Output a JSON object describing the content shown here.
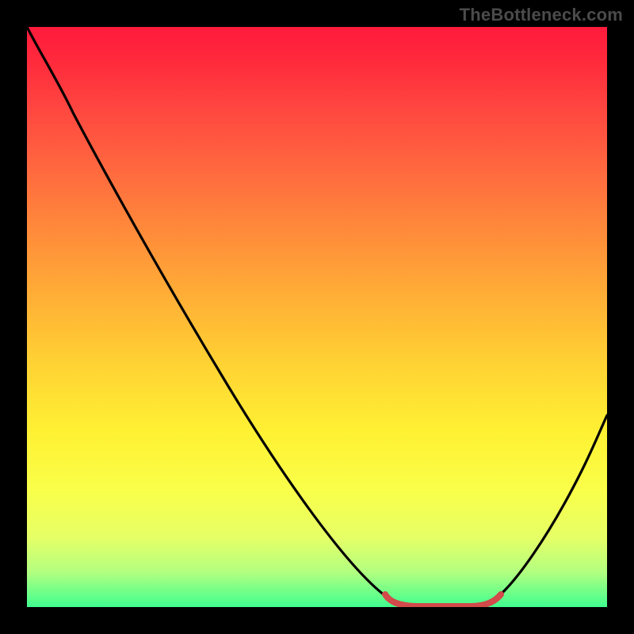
{
  "watermark": "TheBottleneck.com",
  "chart_data": {
    "type": "line",
    "title": "",
    "xlabel": "",
    "ylabel": "",
    "xlim": [
      0,
      1
    ],
    "ylim": [
      0,
      100
    ],
    "gradient_colors": {
      "top": "#ff1a3c",
      "mid_upper": "#ff8a3a",
      "mid": "#fff133",
      "mid_lower": "#e6ff66",
      "bottom": "#3fff8f"
    },
    "series": [
      {
        "name": "bottleneck-curve",
        "color": "#000000",
        "x": [
          0.0,
          0.06,
          0.12,
          0.2,
          0.3,
          0.4,
          0.5,
          0.58,
          0.63,
          0.66,
          0.72,
          0.78,
          0.82,
          0.86,
          0.92,
          1.0
        ],
        "y": [
          100,
          93,
          86,
          75,
          60,
          46,
          31,
          18,
          8,
          2,
          0,
          0,
          2,
          7,
          17,
          33
        ]
      },
      {
        "name": "optimal-range-marker",
        "color": "#d24a4a",
        "x": [
          0.63,
          0.66,
          0.72,
          0.78,
          0.82
        ],
        "y": [
          4,
          1,
          0,
          1,
          4
        ]
      }
    ],
    "optimal_range": {
      "x_start": 0.63,
      "x_end": 0.82
    }
  }
}
